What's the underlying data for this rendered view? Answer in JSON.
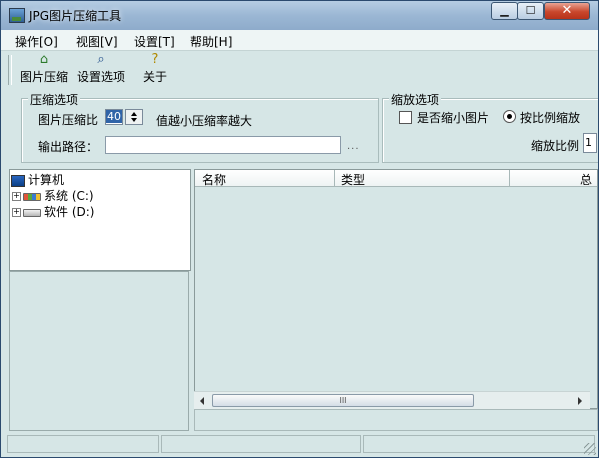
{
  "window": {
    "title": "JPG图片压缩工具",
    "controls": {
      "minimize": "▁",
      "maximize": "☐",
      "close": "✕"
    }
  },
  "menu": {
    "items": [
      "操作[O]",
      "视图[V]",
      "设置[T]",
      "帮助[H]"
    ]
  },
  "toolbar": {
    "items": [
      {
        "label": "图片压缩",
        "icon": "compress-icon"
      },
      {
        "label": "设置选项",
        "icon": "settings-icon"
      },
      {
        "label": "关于",
        "icon": "about-icon"
      }
    ]
  },
  "compression_options": {
    "group_label": "压缩选项",
    "ratio_label": "图片压缩比",
    "ratio_value": "40",
    "ratio_hint": "值越小压缩率越大",
    "output_label": "输出路径：",
    "output_value": "",
    "browse_label": "..."
  },
  "scale_options": {
    "group_label": "缩放选项",
    "shrink_label": "是否缩小图片",
    "shrink_checked": false,
    "proportional_label": "按比例缩放",
    "proportional_selected": true,
    "ratio_label": "缩放比例",
    "ratio_value": "1"
  },
  "tree": {
    "root": "计算机",
    "drives": [
      {
        "label": "系统 (C:)",
        "icon": "windows-drive-icon"
      },
      {
        "label": "软件 (D:)",
        "icon": "hard-drive-icon"
      }
    ]
  },
  "file_list": {
    "columns": [
      "名称",
      "类型",
      "总"
    ],
    "scroll_thumb": "III"
  }
}
